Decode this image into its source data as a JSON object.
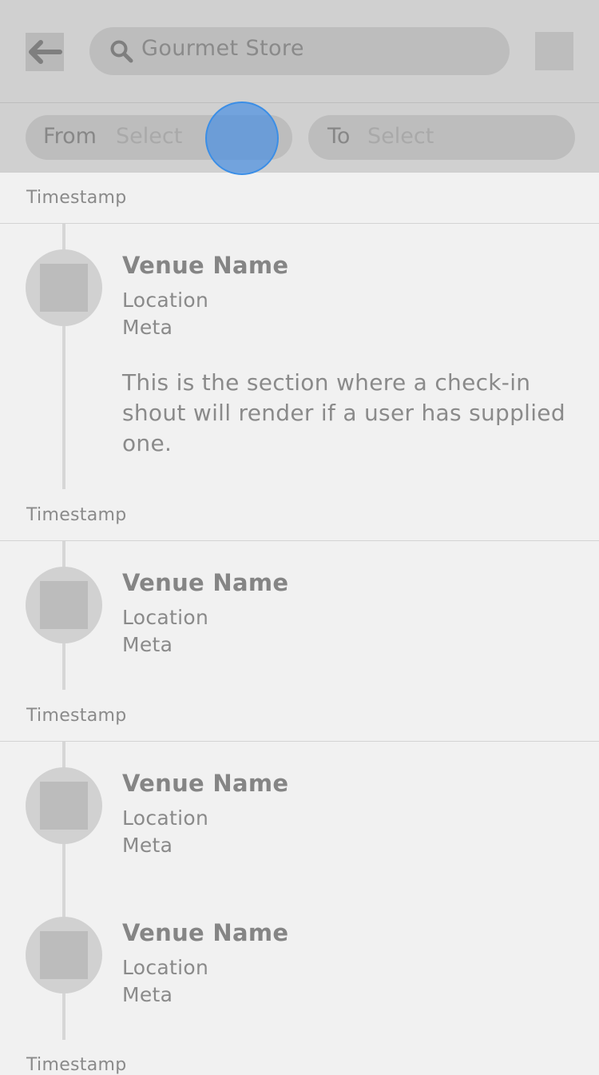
{
  "header": {
    "back_icon": "arrow-left-icon",
    "search_icon": "search-icon",
    "search_value": "Gourmet Store",
    "menu_icon": "square-placeholder-icon"
  },
  "filters": {
    "from_label": "From",
    "from_value": "Select",
    "to_label": "To",
    "to_value": "Select"
  },
  "feed": {
    "groups": [
      {
        "timestamp": "Timestamp",
        "items": [
          {
            "venue": "Venue Name",
            "location": "Location",
            "meta": "Meta",
            "shout": "This is the section where a check-in shout will render if a user has supplied one."
          }
        ]
      },
      {
        "timestamp": "Timestamp",
        "items": [
          {
            "venue": "Venue Name",
            "location": "Location",
            "meta": "Meta"
          }
        ]
      },
      {
        "timestamp": "Timestamp",
        "items": [
          {
            "venue": "Venue Name",
            "location": "Location",
            "meta": "Meta"
          },
          {
            "venue": "Venue Name",
            "location": "Location",
            "meta": "Meta"
          }
        ]
      },
      {
        "timestamp": "Timestamp",
        "items": []
      }
    ]
  },
  "colors": {
    "header_bg": "#d0d0d0",
    "page_bg": "#f1f1f1",
    "touch_indicator": "#4a90e2"
  }
}
